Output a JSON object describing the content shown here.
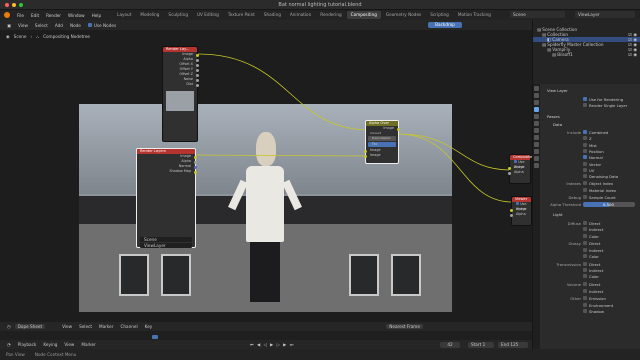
{
  "window": {
    "title": "Bat normal lighting tutorial.blend"
  },
  "menu": [
    "File",
    "Edit",
    "Render",
    "Window",
    "Help"
  ],
  "workspaces": [
    {
      "label": "Layout",
      "active": false
    },
    {
      "label": "Modeling",
      "active": false
    },
    {
      "label": "Sculpting",
      "active": false
    },
    {
      "label": "UV Editing",
      "active": false
    },
    {
      "label": "Texture Paint",
      "active": false
    },
    {
      "label": "Shading",
      "active": false
    },
    {
      "label": "Animation",
      "active": false
    },
    {
      "label": "Rendering",
      "active": false
    },
    {
      "label": "Compositing",
      "active": true
    },
    {
      "label": "Geometry Nodes",
      "active": false
    },
    {
      "label": "Scripting",
      "active": false
    },
    {
      "label": "Motion Tracking",
      "active": false
    }
  ],
  "scene_name": "Scene",
  "view_layer_name": "ViewLayer",
  "node_editor": {
    "header": [
      "View",
      "Select",
      "Add",
      "Node"
    ],
    "use_nodes_label": "Use Nodes",
    "backdrop_label": "Backdrop",
    "breadcrumb": {
      "scene": "Scene",
      "tree": "Compositing Nodetree"
    }
  },
  "nodes": {
    "render_layers_top": {
      "title": "Render Lay...",
      "outputs": [
        "Image",
        "Alpha",
        "Offset X",
        "Offset Y",
        "Offset Z",
        "Noise",
        "Dist"
      ]
    },
    "render_layers": {
      "title": "Render Layers",
      "outputs": [
        "Image",
        "Alpha",
        "Normal",
        "Shadow Map"
      ],
      "scene_label": "Scene",
      "layer_label": "ViewLayer"
    },
    "alpha_over": {
      "title": "Alpha Over",
      "row_image": "Image",
      "option_premul": "Convert Premultiplied",
      "premultiplied": "Premultiplied 0.000",
      "fac_label": "Fac",
      "inputs": [
        "Image",
        "Image"
      ]
    },
    "composite": {
      "title": "Composite",
      "use_alpha_label": "Use Alpha",
      "input": "Image",
      "alpha": "Alpha"
    },
    "viewer": {
      "title": "Viewer",
      "use_alpha_label": "Use Alpha",
      "input": "Image",
      "alpha": "Alpha"
    }
  },
  "timeline": {
    "editor_label": "Dope Sheet",
    "menus": [
      "View",
      "Select",
      "Marker",
      "Channel",
      "Key"
    ],
    "playback_menus": [
      "Playback",
      "Keying",
      "View",
      "Marker"
    ],
    "current_frame": "42",
    "start_label": "Start",
    "start": "1",
    "end_label": "End",
    "end": "125",
    "keyframe_dropdown": "Nearest Frame"
  },
  "statusbar": {
    "left": "Pan View",
    "mid": "Node Context Menu"
  },
  "outliner": {
    "rows": [
      {
        "label": "Scene Collection",
        "indent": 0,
        "selected": false
      },
      {
        "label": "Collection",
        "indent": 1,
        "selected": false
      },
      {
        "label": "Camera",
        "indent": 2,
        "selected": true
      },
      {
        "label": "Spiderfly Master Collection",
        "indent": 1,
        "selected": false
      },
      {
        "label": "VampFly",
        "indent": 2,
        "selected": false
      },
      {
        "label": "Bilsoff1",
        "indent": 3,
        "selected": false
      }
    ]
  },
  "properties": {
    "view_layer_title": "View Layer",
    "use_for_rendering": "Use for Rendering",
    "render_single_layer": "Render Single Layer",
    "passes_title": "Passes",
    "data_title": "Data",
    "include_label": "Include",
    "data_passes": [
      {
        "label": "Combined",
        "checked": true
      },
      {
        "label": "Z",
        "checked": false
      },
      {
        "label": "Mist",
        "checked": false
      },
      {
        "label": "Position",
        "checked": false
      },
      {
        "label": "Normal",
        "checked": true
      },
      {
        "label": "Vector",
        "checked": false
      },
      {
        "label": "UV",
        "checked": false
      },
      {
        "label": "Denoising Data",
        "checked": false
      }
    ],
    "indexes_label": "Indexes",
    "indexes": [
      {
        "label": "Object Index",
        "checked": false
      },
      {
        "label": "Material Index",
        "checked": false
      }
    ],
    "debug_label": "Debug",
    "sample_count": "Sample Count",
    "alpha_threshold_label": "Alpha Threshold",
    "alpha_threshold": "0.500",
    "light_title": "Light",
    "light_groups": [
      {
        "label": "Diffuse",
        "items": [
          "Direct",
          "Indirect",
          "Color"
        ]
      },
      {
        "label": "Glossy",
        "items": [
          "Direct",
          "Indirect",
          "Color"
        ]
      },
      {
        "label": "Transmission",
        "items": [
          "Direct",
          "Indirect",
          "Color"
        ]
      },
      {
        "label": "Volume",
        "items": [
          "Direct",
          "Indirect"
        ]
      },
      {
        "label": "Other",
        "items": [
          "Emission",
          "Environment",
          "Shadow"
        ]
      }
    ]
  },
  "colors": {
    "accent": "#4772b3",
    "wire": "#c7c729",
    "node_header_red": "#b5342f",
    "node_header_yellow": "#6f7021"
  }
}
